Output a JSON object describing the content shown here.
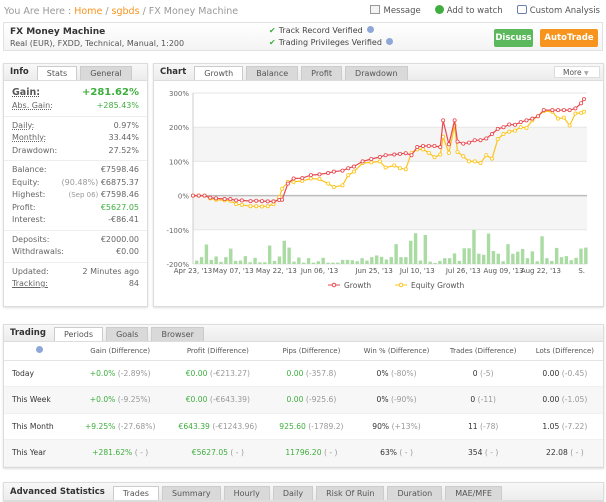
{
  "breadcrumb": {
    "prefix": "You Are Here : ",
    "home": "Home",
    "user": "sgbds",
    "current": "FX Money Machine"
  },
  "top_links": [
    {
      "label": "Message",
      "icon": "envelope-icon"
    },
    {
      "label": "Add to watch",
      "icon": "plus-circle-icon"
    },
    {
      "label": "Custom Analysis",
      "icon": "analysis-icon"
    }
  ],
  "header": {
    "title": "FX Money Machine",
    "subtitle": "Real (EUR), FXDD, Technical, Manual, 1:200",
    "verified": [
      "Track Record Verified",
      "Trading Privileges Verified"
    ],
    "discuss": "Discuss",
    "autotrade": "AutoTrade"
  },
  "colors": {
    "accent_orange": "#f7941d",
    "discuss_green": "#5cb85c",
    "positive": "#3fae3f",
    "growth": "#e8474f",
    "equity": "#fcc419",
    "bars": "#a9dba3"
  },
  "info": {
    "title": "Info",
    "tabs": [
      "Stats",
      "General"
    ],
    "gain_label": "Gain:",
    "gain": "+281.62%",
    "abs_gain_label": "Abs. Gain:",
    "abs_gain": "+285.43%",
    "rows1": [
      [
        "Daily:",
        "0.97%"
      ],
      [
        "Monthly:",
        "33.44%"
      ],
      [
        "Drawdown:",
        "27.52%"
      ]
    ],
    "balance_label": "Balance:",
    "balance": "€7598.46",
    "equity_label": "Equity:",
    "equity_note": "(90.48%)",
    "equity": "€6875.37",
    "highest_label": "Highest:",
    "highest_note": "(Sep 06)",
    "highest": "€7598.46",
    "profit_label": "Profit:",
    "profit": "€5627.05",
    "interest_label": "Interest:",
    "interest": "-€86.41",
    "rows3": [
      [
        "Deposits:",
        "€2000.00"
      ],
      [
        "Withdrawals:",
        "€0.00"
      ]
    ],
    "updated_label": "Updated:",
    "updated": "2 Minutes ago",
    "tracking_label": "Tracking:",
    "tracking": "84"
  },
  "chart": {
    "title": "Chart",
    "tabs": [
      "Growth",
      "Balance",
      "Profit",
      "Drawdown"
    ],
    "more": "More"
  },
  "chart_data": {
    "type": "line",
    "ylim": [
      -200,
      300
    ],
    "yticks": [
      "300%",
      "200%",
      "100%",
      "0%",
      "-100%",
      "-200%"
    ],
    "ytick_values": [
      300,
      200,
      100,
      0,
      -100,
      -200
    ],
    "xticks": [
      {
        "label": "Apr 23, '13",
        "date": "2013-04-23"
      },
      {
        "label": "May 07, '13",
        "date": "2013-05-07"
      },
      {
        "label": "May 22, '13",
        "date": "2013-05-22"
      },
      {
        "label": "Jun 06, '13",
        "date": "2013-06-06"
      },
      {
        "label": "Jun 25, '13",
        "date": "2013-06-25"
      },
      {
        "label": "Jul 10, '13",
        "date": "2013-07-10"
      },
      {
        "label": "Jul 26, '13",
        "date": "2013-07-26"
      },
      {
        "label": "Aug 09, '13",
        "date": "2013-08-09"
      },
      {
        "label": "Aug 22, '13",
        "date": "2013-08-22"
      },
      {
        "label": "S.",
        "date": "2013-09-06"
      }
    ],
    "x": [
      "2013-04-23",
      "2013-04-25",
      "2013-04-27",
      "2013-04-29",
      "2013-05-01",
      "2013-05-04",
      "2013-05-06",
      "2013-05-08",
      "2013-05-10",
      "2013-05-13",
      "2013-05-15",
      "2013-05-17",
      "2013-05-19",
      "2013-05-21",
      "2013-05-23",
      "2013-05-24",
      "2013-05-26",
      "2013-05-28",
      "2013-05-31",
      "2013-06-03",
      "2013-06-06",
      "2013-06-09",
      "2013-06-11",
      "2013-06-14",
      "2013-06-16",
      "2013-06-18",
      "2013-06-21",
      "2013-06-24",
      "2013-06-27",
      "2013-06-29",
      "2013-07-02",
      "2013-07-04",
      "2013-07-06",
      "2013-07-08",
      "2013-07-10",
      "2013-07-12",
      "2013-07-14",
      "2013-07-16",
      "2013-07-18",
      "2013-07-19",
      "2013-07-21",
      "2013-07-23",
      "2013-07-24",
      "2013-07-26",
      "2013-07-28",
      "2013-07-30",
      "2013-08-01",
      "2013-08-03",
      "2013-08-05",
      "2013-08-07",
      "2013-08-09",
      "2013-08-11",
      "2013-08-13",
      "2013-08-15",
      "2013-08-17",
      "2013-08-19",
      "2013-08-21",
      "2013-08-23",
      "2013-08-26",
      "2013-08-28",
      "2013-08-30",
      "2013-09-01",
      "2013-09-03",
      "2013-09-05",
      "2013-09-06"
    ],
    "series": [
      {
        "name": "Growth",
        "values": [
          0,
          0,
          0,
          -6,
          -8,
          -10,
          -10,
          -14,
          -14,
          -16,
          -15,
          -16,
          -17,
          -17,
          -13,
          -12,
          35,
          50,
          51,
          60,
          62,
          66,
          70,
          73,
          80,
          85,
          100,
          107,
          113,
          118,
          120,
          122,
          124,
          118,
          142,
          145,
          145,
          145,
          142,
          220,
          150,
          220,
          158,
          152,
          155,
          162,
          162,
          167,
          180,
          195,
          200,
          208,
          207,
          215,
          220,
          225,
          232,
          250,
          250,
          250,
          250,
          250,
          255,
          270,
          282
        ]
      },
      {
        "name": "Equity Growth",
        "values": [
          0,
          0,
          0,
          -8,
          -12,
          -14,
          -15,
          -25,
          -27,
          -31,
          -31,
          -32,
          -31,
          -25,
          -5,
          20,
          40,
          40,
          43,
          50,
          48,
          35,
          25,
          30,
          60,
          70,
          95,
          97,
          100,
          82,
          88,
          80,
          77,
          125,
          135,
          135,
          125,
          112,
          120,
          172,
          125,
          205,
          128,
          115,
          100,
          100,
          95,
          118,
          108,
          165,
          180,
          187,
          190,
          200,
          198,
          220,
          232,
          247,
          245,
          225,
          228,
          205,
          240,
          242,
          245
        ]
      }
    ],
    "bars": [
      10,
      20,
      57,
      12,
      22,
      6,
      20,
      45,
      9,
      10,
      23,
      5,
      18,
      5,
      5,
      54,
      9,
      22,
      68,
      48,
      7,
      19,
      4,
      17,
      4,
      8,
      18,
      4,
      4,
      4,
      12,
      12,
      11,
      8,
      17,
      10,
      20,
      25,
      21,
      13,
      20,
      58,
      20,
      20,
      68,
      90,
      10,
      85,
      7,
      3,
      9,
      17,
      17,
      31,
      9,
      46,
      46,
      100,
      30,
      27,
      89,
      38,
      30,
      8,
      58,
      30,
      36,
      44,
      17,
      37,
      8,
      81,
      17,
      9,
      47,
      20,
      23,
      11,
      18,
      45,
      48
    ]
  },
  "trading": {
    "title": "Trading",
    "tabs": [
      "Periods",
      "Goals",
      "Browser"
    ],
    "headers": [
      "Gain (Difference)",
      "Profit (Difference)",
      "Pips (Difference)",
      "Win % (Difference)",
      "Trades (Difference)",
      "Lots (Difference)"
    ],
    "rows": [
      {
        "period": "Today",
        "gain": "+0.0%",
        "gain_d": "(-2.89%)",
        "profit": "€0.00",
        "profit_d": "(-€213.27)",
        "pips": "0.00",
        "pips_d": "(-357.8)",
        "win": "0%",
        "win_d": "(-80%)",
        "trades": "0",
        "trades_d": "(-5)",
        "lots": "0.00",
        "lots_d": "(-0.45)"
      },
      {
        "period": "This Week",
        "gain": "+0.0%",
        "gain_d": "(-9.25%)",
        "profit": "€0.00",
        "profit_d": "(-€643.39)",
        "pips": "0.00",
        "pips_d": "(-925.6)",
        "win": "0%",
        "win_d": "(-90%)",
        "trades": "0",
        "trades_d": "(-11)",
        "lots": "0.00",
        "lots_d": "(-1.05)"
      },
      {
        "period": "This Month",
        "gain": "+9.25%",
        "gain_d": "(-27.68%)",
        "profit": "€643.39",
        "profit_d": "(-€1243.96)",
        "pips": "925.60",
        "pips_d": "(-1789.2)",
        "win": "90%",
        "win_d": "(+13%)",
        "trades": "11",
        "trades_d": "(-78)",
        "lots": "1.05",
        "lots_d": "(-7.22)"
      },
      {
        "period": "This Year",
        "gain": "+281.62%",
        "gain_d": "( - )",
        "profit": "€5627.05",
        "profit_d": "( - )",
        "pips": "11796.20",
        "pips_d": "( - )",
        "win": "63%",
        "win_d": "( - )",
        "trades": "354",
        "trades_d": "( - )",
        "lots": "22.08",
        "lots_d": "( - )"
      }
    ]
  },
  "advanced": {
    "title": "Advanced Statistics",
    "tabs": [
      "Trades",
      "Summary",
      "Hourly",
      "Daily",
      "Risk Of Ruin",
      "Duration",
      "MAE/MFE"
    ]
  }
}
